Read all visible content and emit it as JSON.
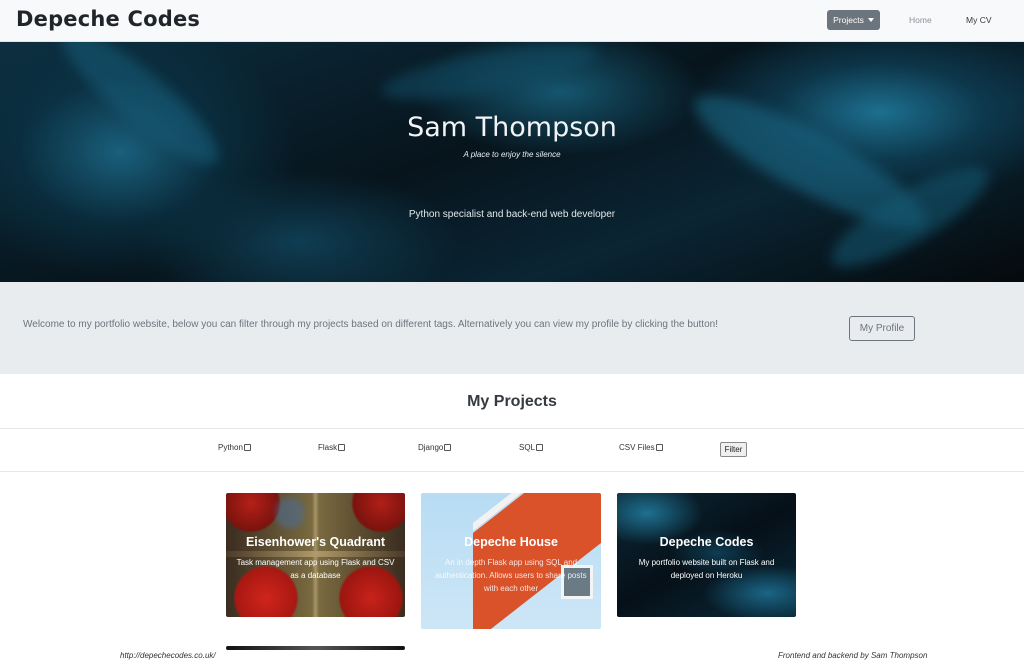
{
  "navbar": {
    "brand": "Depeche Codes",
    "projects_label": "Projects",
    "home_label": "Home",
    "cv_label": "My CV"
  },
  "hero": {
    "name": "Sam Thompson",
    "tagline": "A place to enjoy the silence",
    "subtitle": "Python specialist and back-end web developer"
  },
  "intro": {
    "text": "Welcome to my portfolio website, below you can filter through my projects based on different tags. Alternatively you can view my profile by clicking the button!",
    "profile_button": "My Profile"
  },
  "projects": {
    "title": "My Projects",
    "filters": [
      "Python",
      "Flask",
      "Django",
      "SQL",
      "CSV Files"
    ],
    "filter_button": "Filter",
    "cards": [
      {
        "title": "Eisenhower's Quadrant",
        "description": "Task management app using Flask and CSV as a database"
      },
      {
        "title": "Depeche House",
        "description": "An in depth Flask app using SQL and authentication. Allows users to share posts with each other"
      },
      {
        "title": "Depeche Codes",
        "description": "My portfolio website built on Flask and deployed on Heroku"
      }
    ]
  },
  "footer": {
    "url": "http://depechecodes.co.uk/",
    "credit": "Frontend and backend by Sam Thompson"
  },
  "colors": {
    "navbar_bg": "#f8f9fa",
    "secondary": "#6c757d",
    "jumbotron_bg": "#e9ecef"
  }
}
